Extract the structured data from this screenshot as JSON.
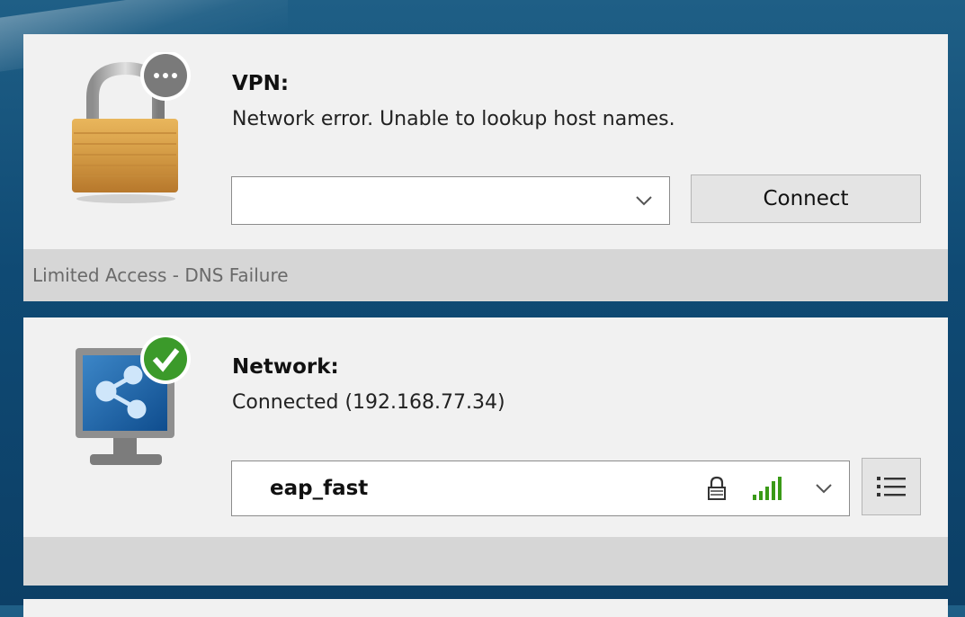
{
  "vpn": {
    "title": "VPN:",
    "status": "Network error. Unable to lookup host names.",
    "combo_value": "",
    "connect_label": "Connect",
    "footer": "Limited Access - DNS Failure",
    "icon": "padlock-with-ellipsis-badge-icon"
  },
  "network": {
    "title": "Network:",
    "status": "Connected (192.168.77.34)",
    "selected_network": "eap_fast",
    "icons": [
      "lock-icon",
      "signal-strength-icon",
      "chevron-down-icon",
      "list-icon"
    ],
    "footer": "",
    "icon": "monitor-with-check-badge-icon",
    "signal_color": "#3a9a17",
    "check_badge_color": "#3b9a2a"
  },
  "colors": {
    "panel_bg": "#f1f1f1",
    "footer_bg": "#d6d6d6",
    "desktop_bg": "#0f4a74"
  }
}
